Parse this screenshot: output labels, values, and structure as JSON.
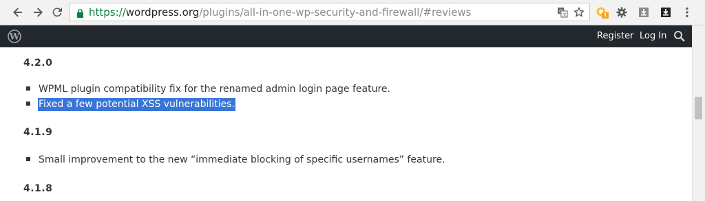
{
  "browser": {
    "url_scheme": "https://",
    "url_host": "wordpress.org",
    "url_path": "/plugins/all-in-one-wp-security-and-firewall/#reviews",
    "extension_badge": "1",
    "icons": [
      "back-icon",
      "forward-icon",
      "reload-icon",
      "lock-icon",
      "translate-icon",
      "star-icon",
      "extension-icon",
      "settings-gear-icon",
      "download-icon",
      "download-dark-icon",
      "menu-icon"
    ]
  },
  "wpbar": {
    "register": "Register",
    "login": "Log In"
  },
  "changelog": [
    {
      "version": "4.2.0",
      "items": [
        "WPML plugin compatibility fix for the renamed admin login page feature.",
        "Fixed a few potential XSS vulnerabilities."
      ]
    },
    {
      "version": "4.1.9",
      "items": [
        "Small improvement to the new “immediate blocking of specific usernames” feature."
      ]
    },
    {
      "version": "4.1.8",
      "items": []
    }
  ],
  "colors": {
    "selection": "#3875d7",
    "wpbar": "#23282d",
    "https_green": "#0b8043"
  }
}
